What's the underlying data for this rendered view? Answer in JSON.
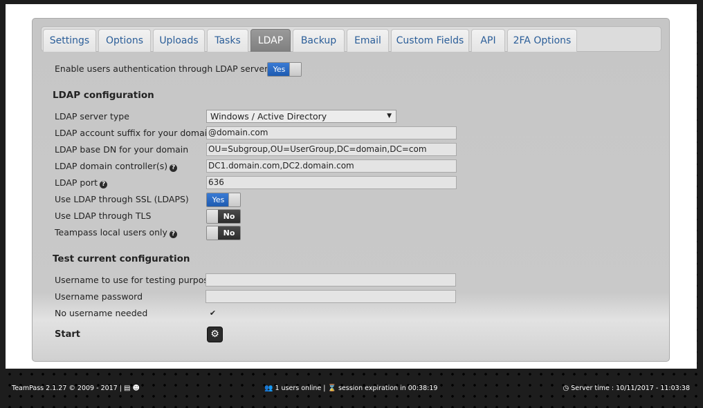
{
  "tabs": [
    {
      "label": "Settings"
    },
    {
      "label": "Options"
    },
    {
      "label": "Uploads"
    },
    {
      "label": "Tasks"
    },
    {
      "label": "LDAP"
    },
    {
      "label": "Backup"
    },
    {
      "label": "Email"
    },
    {
      "label": "Custom Fields"
    },
    {
      "label": "API"
    },
    {
      "label": "2FA Options"
    }
  ],
  "active_tab": "LDAP",
  "enable_ldap": {
    "label": "Enable users authentication through LDAP server",
    "toggle": "Yes"
  },
  "ldap_config": {
    "heading": "LDAP configuration",
    "server_type": {
      "label": "LDAP server type",
      "value": "Windows / Active Directory"
    },
    "account_suffix": {
      "label": "LDAP account suffix for your domain",
      "value": "@domain.com"
    },
    "base_dn": {
      "label": "LDAP base DN for your domain",
      "value": "OU=Subgroup,OU=UserGroup,DC=domain,DC=com"
    },
    "domain_controllers": {
      "label": "LDAP domain controller(s)",
      "value": "DC1.domain.com,DC2.domain.com"
    },
    "port": {
      "label": "LDAP port",
      "value": "636"
    },
    "ssl": {
      "label": "Use LDAP through SSL (LDAPS)",
      "toggle": "Yes"
    },
    "tls": {
      "label": "Use LDAP through TLS",
      "toggle": "No"
    },
    "local_only": {
      "label": "Teampass local users only",
      "toggle": "No"
    }
  },
  "test_config": {
    "heading": "Test current configuration",
    "username": {
      "label": "Username to use for testing purpose",
      "value": ""
    },
    "password": {
      "label": "Username password",
      "value": ""
    },
    "no_username": {
      "label": "No username needed",
      "checked": true
    },
    "start": {
      "label": "Start"
    }
  },
  "footer": {
    "version": "TeamPass 2.1.27",
    "copyright": "© 2009 - 2017",
    "separator": "|",
    "users_online": "1 users online",
    "session": "session expiration in 00:38:19",
    "server_time": "Server time : 10/11/2017 - 11:03:38"
  },
  "colors": {
    "tab_text": "#2a5d98",
    "toggle_on": "#1e5bb0",
    "panel": "#c6c6c6"
  },
  "icons": [
    "question-circle-icon",
    "check-icon",
    "cogs-icon",
    "copyright-icon",
    "book-icon",
    "reddit-icon",
    "users-icon",
    "hourglass-icon",
    "clock-icon",
    "dropdown-caret-icon"
  ]
}
